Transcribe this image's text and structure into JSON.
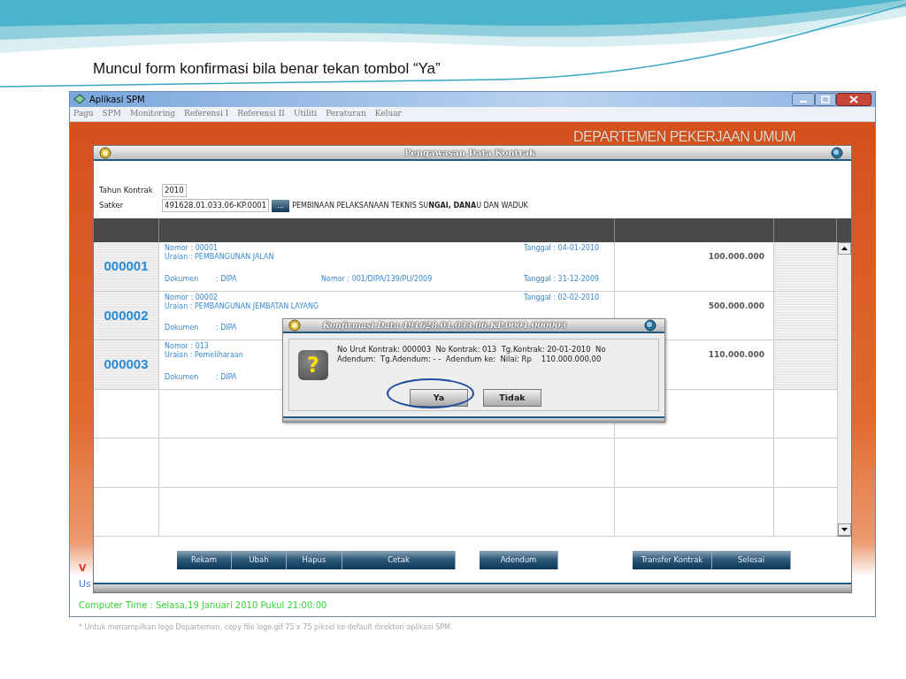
{
  "caption": "Muncul form konfirmasi bila benar tekan tombol “Ya”",
  "window": {
    "title": "Aplikasi SPM"
  },
  "menu": [
    "Pagu",
    "SPM",
    "Monitoring",
    "Referensi I",
    "Referensi II",
    "Utiliti",
    "Peraturan",
    "Keluar"
  ],
  "banner": "DEPARTEMEN PEKERJAAN UMUM",
  "form": {
    "title": "Pengawasan Data Kontrak",
    "fields": [
      {
        "label": "Tahun Kontrak",
        "value": "2010"
      },
      {
        "label": "Satker",
        "value": "491628.01.033.06-KP.0001",
        "button": "...",
        "description": "PEMBINAAN PELAKSANAAN TEKNIS SU**NGAI, DANA**U DAN WADUK"
      }
    ],
    "rows": [
      {
        "no": "000001",
        "nomor": "Nomor : 00001",
        "uraian": "Uraian : PEMBANGUNAN JALAN",
        "tanggal": "Tanggal : 04-01-2010",
        "dokumen_label": "Dokumen",
        "dokumen_value": ": DIPA",
        "dok_nomor": "Nomor : 001/DIPA/139/PU/2009",
        "dok_tanggal": "Tanggal : 31-12-2009",
        "nilai": "100.000.000"
      },
      {
        "no": "000002",
        "nomor": "Nomor : 00002",
        "uraian": "Uraian : PEMBANGUNAN JEMBATAN LAYANG",
        "tanggal": "Tanggal : 02-02-2010",
        "dokumen_label": "Dokumen",
        "dokumen_value": ": DIPA",
        "nilai": "500.000.000"
      },
      {
        "no": "000003",
        "nomor": "Nomor : 013",
        "uraian": "Uraian : Pemeliharaan",
        "dokumen_label": "Dokumen",
        "dokumen_value": ": DIPA",
        "nilai": "110.000.000"
      }
    ],
    "buttons": [
      [
        "Rekam",
        "Ubah",
        "Hapus",
        "Cetak"
      ],
      [
        "Adendum"
      ],
      [
        "Transfer Kontrak",
        "Selesai"
      ]
    ]
  },
  "dialog": {
    "title": "Konfirmasi Data 491628.01.033.06.KP.0001.000003",
    "icon": "?",
    "message": "No Urut Kontrak: 000003  No Kontrak: 013  Tg.Kontrak: 20-01-2010  No Adendum:  Tg.Adendum: - -  Adendum ke:  Nilai: Rp    110.000.000,00",
    "buttons": [
      {
        "label": "Ya",
        "highlighted": true
      },
      {
        "label": "Tidak",
        "highlighted": false
      }
    ]
  },
  "footer": {
    "fragments": [
      "V",
      "Us"
    ],
    "time": "Computer Time : Selasa,19 Januari 2010 Pukul 21:00:00",
    "note": "* Untuk menampilkan logo Departemen, copy file logo.gif 75 x 75 piksel ke default direktori aplikasi SPM."
  }
}
